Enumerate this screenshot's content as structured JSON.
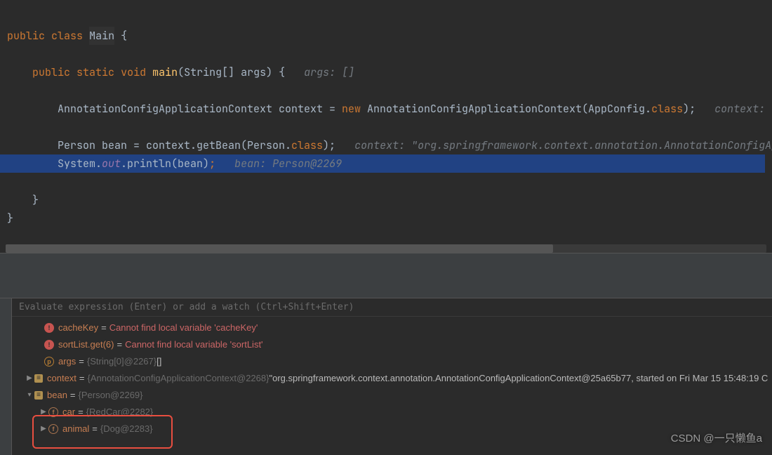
{
  "code": {
    "l1_public": "public",
    "l1_class": "class",
    "l1_main": "Main",
    "l1_brace": " {",
    "l3_public": "public",
    "l3_static": "static",
    "l3_void": "void",
    "l3_main": "main",
    "l3_sig": "(String[] args) {",
    "l3_hint": "args: []",
    "l5_txt": "AnnotationConfigApplicationContext context = ",
    "l5_new": "new",
    "l5_ctor": " AnnotationConfigApplicationContext(AppConfig.",
    "l5_class": "class",
    "l5_end": ");",
    "l5_hint": "context: \"",
    "l7_txt": "Person bean = context.getBean(Person.",
    "l7_class": "class",
    "l7_end": ");",
    "l7_hint": "context: \"org.springframework.context.annotation.AnnotationConfigAp",
    "l8_sys": "System.",
    "l8_out": "out",
    "l8_print": ".println(bean)",
    "l8_semi": ";",
    "l8_hint": "bean: Person@2269",
    "l10_brace": "}",
    "l11_brace": "}"
  },
  "eval_placeholder": "Evaluate expression (Enter) or add a watch (Ctrl+Shift+Enter)",
  "vars": {
    "v0_name": "cacheKey",
    "v0_err": "Cannot find local variable 'cacheKey'",
    "v1_name": "sortList.get(6)",
    "v1_err": "Cannot find local variable 'sortList'",
    "v2_name": "args",
    "v2_type": "{String[0]@2267}",
    "v2_val": " []",
    "v3_name": "context",
    "v3_type": "{AnnotationConfigApplicationContext@2268}",
    "v3_val": " \"org.springframework.context.annotation.AnnotationConfigApplicationContext@25a65b77, started on Fri Mar 15 15:48:19 C",
    "v4_name": "bean",
    "v4_type": "{Person@2269}",
    "v5_name": "car",
    "v5_type": "{RedCar@2282}",
    "v6_name": "animal",
    "v6_type": "{Dog@2283}"
  },
  "watermark": "CSDN @一只懒鱼a"
}
